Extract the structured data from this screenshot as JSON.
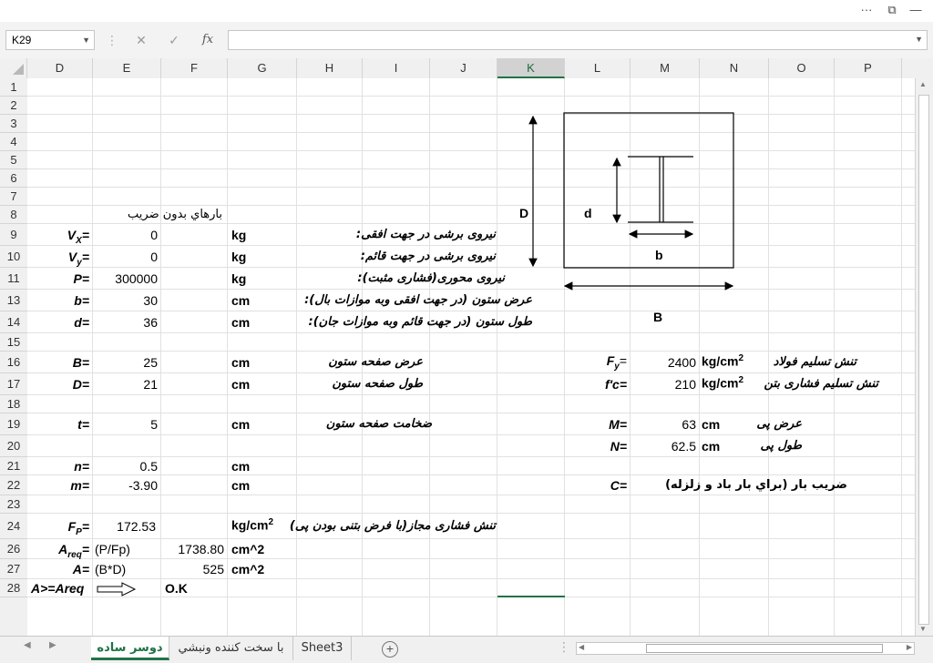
{
  "window": {
    "btn_ribbon": "···",
    "btn_restore": "⧉",
    "btn_minimize": "—",
    "btn_close": "✕"
  },
  "formula_bar": {
    "name_box": "K29",
    "fx_label": "fx",
    "formula": ""
  },
  "columns": [
    "D",
    "E",
    "F",
    "G",
    "H",
    "I",
    "J",
    "K",
    "L",
    "M",
    "N",
    "O",
    "P"
  ],
  "selected_column": "K",
  "rows": [
    "1",
    "2",
    "3",
    "4",
    "5",
    "6",
    "7",
    "8",
    "9",
    "10",
    "11",
    "13",
    "14",
    "15",
    "16",
    "17",
    "18",
    "19",
    "20",
    "21",
    "22",
    "23",
    "24",
    "26",
    "27",
    "28"
  ],
  "cells": {
    "e8": "بارهاي بدون ضريب",
    "d9_main": "V",
    "d9_sub": "X",
    "d9_eq": "=",
    "e9": "0",
    "g9": "kg",
    "h9": "نیروی برشی در جهت افقی:",
    "d10_main": "V",
    "d10_sub": "y",
    "d10_eq": "=",
    "e10": "0",
    "g10": "kg",
    "h10": "نیروی برشی در جهت قائم:",
    "d11": "P=",
    "e11": "300000",
    "g11": "kg",
    "h11": "نیروی محوری(فشاری مثبت):",
    "d13": "b=",
    "e13": "30",
    "g13": "cm",
    "h13": "عرض ستون (در جهت افقی وبه موازات بال):",
    "d14": "d=",
    "e14": "36",
    "g14": "cm",
    "h14": "طول ستون (در جهت قائم وبه موازات جان):",
    "d16": "B=",
    "e16": "25",
    "g16": "cm",
    "h16": "عرض صفحه ستون",
    "d17": "D=",
    "e17": "21",
    "g17": "cm",
    "h17": "طول صفحه ستون",
    "d19": "t=",
    "e19": "5",
    "g19": "cm",
    "h19": "ضخامت صفحه ستون",
    "d21": "n=",
    "e21": "0.5",
    "g21": "cm",
    "d22": "m=",
    "e22": "-3.90",
    "g22": "cm",
    "d24_main": "F",
    "d24_sub": "P",
    "d24_eq": "=",
    "e24": "172.53",
    "g24": "kg/cm",
    "g24_sup": "2",
    "h24": "تنش فشاری مجاز(با فرض بتنی بودن پی)",
    "d26_main": "A",
    "d26_sub": "req",
    "d26_eq": "=",
    "e26": "(P/Fp)",
    "f26": "1738.80",
    "g26": "cm^2",
    "d27": "A=",
    "e27": "(B*D)",
    "f27": "525",
    "g27": "cm^2",
    "d28": "A>=Areq",
    "f28": "O.K",
    "l16_main": "F",
    "l16_sub": "y",
    "l16_eq": "=",
    "m16": "2400",
    "n16": "kg/cm",
    "n16_sup": "2",
    "o16": "تنش تسلیم فولاد",
    "l17": "f'c=",
    "m17": "210",
    "n17": "kg/cm",
    "n17_sup": "2",
    "o17": "تنش تسلیم فشاری بتن",
    "l19": "M=",
    "m19": "63",
    "n19": "cm",
    "o19": "عرض پی",
    "l20": "N=",
    "m20": "62.5",
    "n20": "cm",
    "o20": "طول پی",
    "l22": "C=",
    "n22": "ضریب بار (براي بار باد و زلزله)"
  },
  "diagram": {
    "label_D": "D",
    "label_d": "d",
    "label_b": "b",
    "label_B": "B"
  },
  "sheet_tabs": [
    {
      "label": "دوسر ساده",
      "active": true
    },
    {
      "label": "با سخت کننده ونبشي",
      "active": false
    },
    {
      "label": "Sheet3",
      "active": false
    }
  ],
  "add_sheet": "+"
}
